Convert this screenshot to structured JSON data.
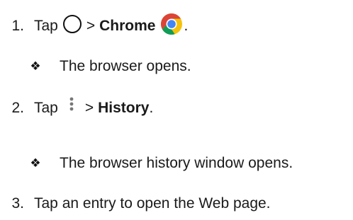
{
  "steps": [
    {
      "number": "1.",
      "prefix": "Tap",
      "separator": ">",
      "target": "Chrome",
      "suffix": ".",
      "icons": [
        "home-circle-icon",
        "chrome-logo-icon"
      ]
    },
    {
      "result": "The browser opens.",
      "bullet_glyph": "❖"
    },
    {
      "number": "2.",
      "prefix": "Tap",
      "separator": ">",
      "target": "History",
      "suffix": ".",
      "icons": [
        "more-vertical-icon"
      ]
    },
    {
      "result": "The browser history window opens.",
      "bullet_glyph": "❖"
    },
    {
      "number": "3.",
      "text": "Tap an entry to open the Web page."
    }
  ],
  "colors": {
    "text": "#1a1a1a",
    "chrome_red": "#db4437",
    "chrome_yellow": "#f4c20d",
    "chrome_green": "#0f9d58",
    "chrome_blue": "#4285f4"
  }
}
